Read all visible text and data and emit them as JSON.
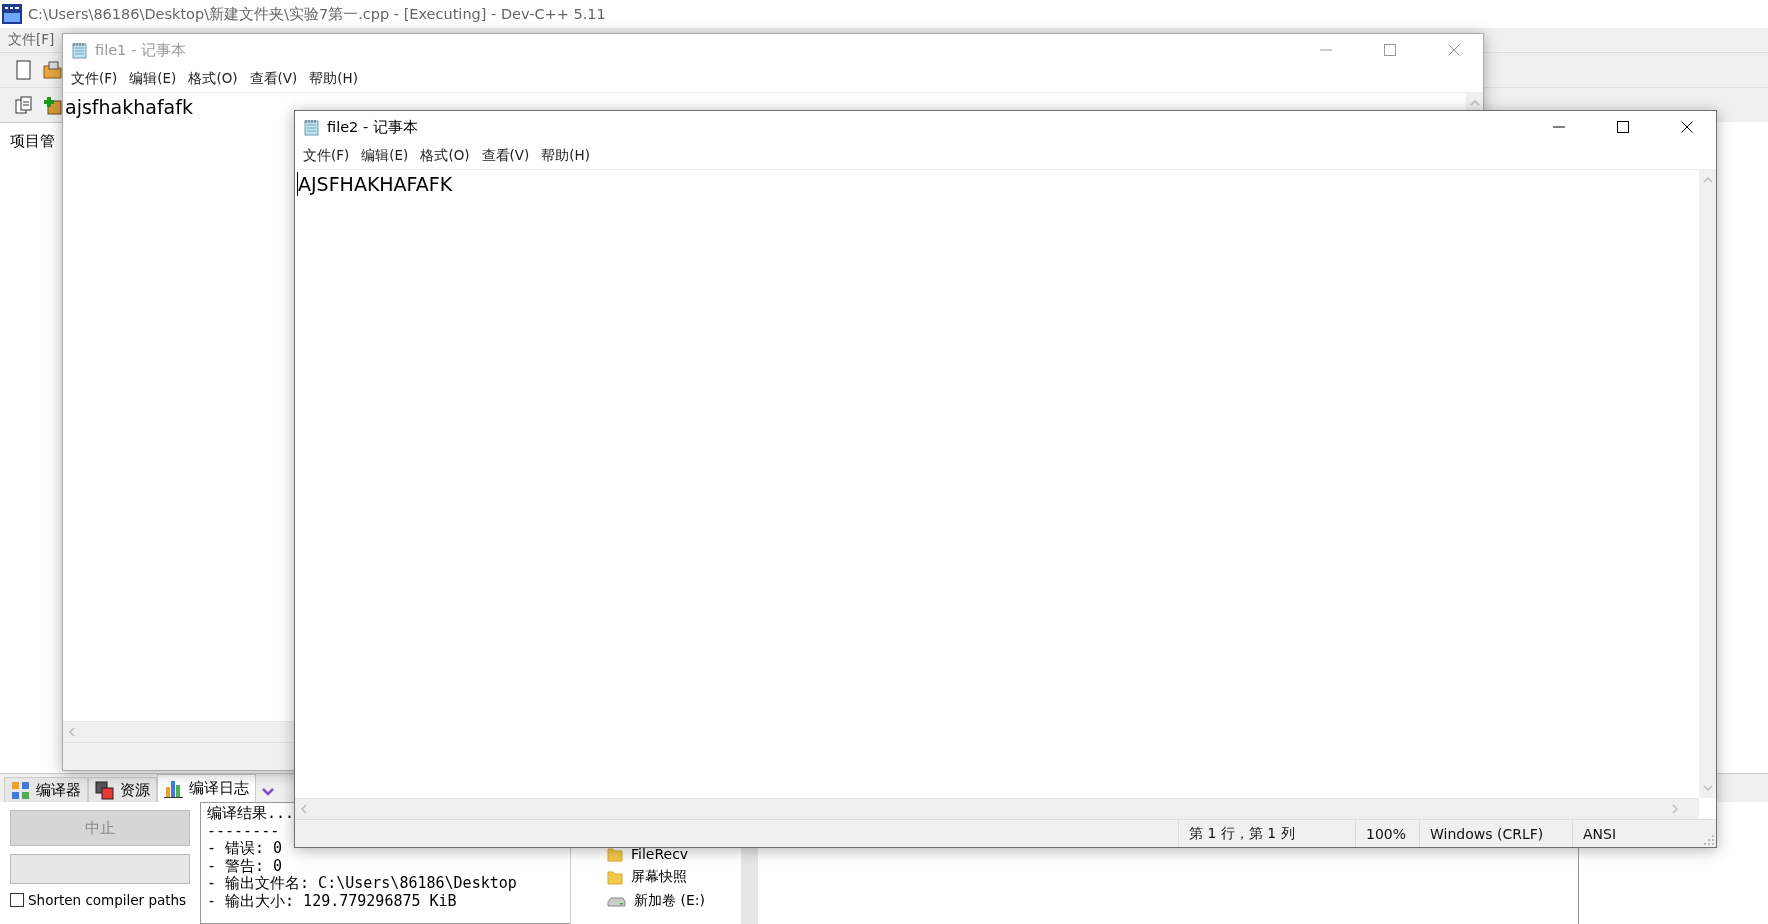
{
  "devcpp": {
    "title": "C:\\Users\\86186\\Desktop\\新建文件夹\\实验7第一.cpp - [Executing] - Dev-C++ 5.11",
    "menu": [
      "文件[F]"
    ],
    "panel_label": "项目管",
    "bottom_tabs": [
      {
        "label": "编译器",
        "selected": false
      },
      {
        "label": "资源",
        "selected": false
      },
      {
        "label": "编译日志",
        "selected": true
      }
    ],
    "abort_button": {
      "label": "中止",
      "disabled": true
    },
    "shorten_paths": {
      "label": "Shorten compiler paths",
      "checked": false
    },
    "log_lines": [
      "编译结果...",
      "--------",
      "- 错误: 0",
      "- 警告: 0",
      "- 输出文件名: C:\\Users\\86186\\Desktop",
      "- 输出大小: 129.779296875 KiB"
    ]
  },
  "explorer": {
    "items": [
      {
        "label": "FileRecv",
        "kind": "folder"
      },
      {
        "label": "屏幕快照",
        "kind": "folder"
      },
      {
        "label": "新加卷 (E:)",
        "kind": "drive"
      }
    ]
  },
  "notepad_windows": [
    {
      "title": "file1 - 记事本",
      "active": false,
      "menu": [
        "文件(F)",
        "编辑(E)",
        "格式(O)",
        "查看(V)",
        "帮助(H)"
      ],
      "text": "ajsfhakhafafk"
    },
    {
      "title": "file2 - 记事本",
      "active": true,
      "menu": [
        "文件(F)",
        "编辑(E)",
        "格式(O)",
        "查看(V)",
        "帮助(H)"
      ],
      "text": "AJSFHAKHAFAFK",
      "status_bar": [
        "第 1 行，第 1 列",
        "100%",
        "Windows (CRLF)",
        "ANSI"
      ]
    }
  ]
}
